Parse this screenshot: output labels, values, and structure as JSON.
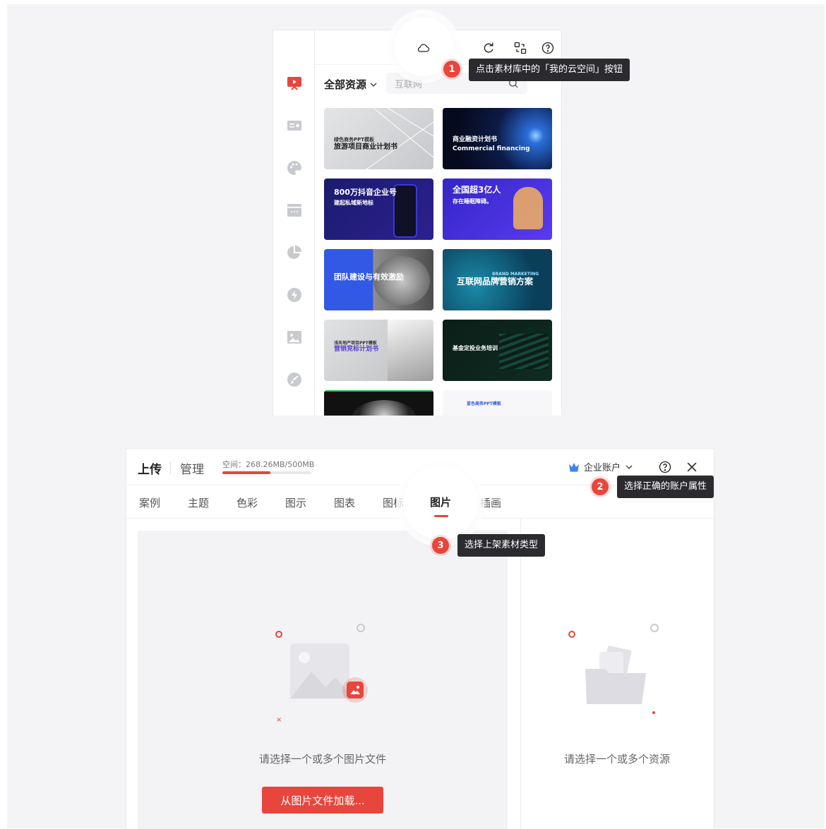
{
  "library": {
    "toolbar_icons": [
      "cloud-icon",
      "refresh-icon",
      "exchange-icon",
      "help-icon",
      "close-icon"
    ],
    "rail_icons": [
      "presentation-icon",
      "card-icon",
      "palette-icon",
      "table-icon",
      "pie-chart-icon",
      "bolt-icon",
      "image-icon",
      "brush-icon"
    ],
    "filter_label": "全部资源",
    "search_placeholder": "互联网",
    "thumbnails": [
      {
        "title": "旅游项目商业计划书",
        "subtitle": "绿色商务PPT模板",
        "bg": "#d9dadc",
        "fg": "#1a1a1a"
      },
      {
        "title": "商业融资计划书",
        "subtitle": "Commercial financing",
        "bg": "#0a1330",
        "fg": "#ffffff"
      },
      {
        "title": "800万抖音企业号",
        "subtitle": "建起私域新地标",
        "bg": "#1f1a6b",
        "fg": "#ffffff"
      },
      {
        "title": "全国超3亿人",
        "subtitle": "存在睡眠障碍。",
        "bg": "#3a2fc9",
        "fg": "#ffffff"
      },
      {
        "title": "团队建设与有效激励",
        "subtitle": "",
        "bg": "#3159e6",
        "fg": "#ffffff"
      },
      {
        "title": "互联网品牌营销方案",
        "subtitle": "BRAND MARKETING PLAN",
        "bg": "#0f5a7a",
        "fg": "#ffffff"
      },
      {
        "title": "营销竞标计划书",
        "subtitle": "浅灰地产项目PPT模板",
        "bg": "#d7d8da",
        "fg": "#1a1a1a"
      },
      {
        "title": "基金定投业务培训",
        "subtitle": "",
        "bg": "#0c2a22",
        "fg": "#ffffff"
      },
      {
        "title": "",
        "subtitle": "",
        "bg": "#111111",
        "fg": "#ffffff"
      },
      {
        "title": "",
        "subtitle": "蓝色商务PPT模板",
        "bg": "#f7f7f9",
        "fg": "#3159e6"
      }
    ]
  },
  "tips": {
    "step1": {
      "num": "1",
      "text": "点击素材库中的「我的云空间」按钮"
    },
    "step2": {
      "num": "2",
      "text": "选择正确的账户属性"
    },
    "step3": {
      "num": "3",
      "text": "选择上架素材类型"
    }
  },
  "dialog": {
    "upload_tab": "上传",
    "manage_tab": "管理",
    "space_text": "空间：268.26MB/500MB",
    "space_used_fraction": 0.537,
    "account_label": "企业账户",
    "tabs": [
      "案例",
      "主题",
      "色彩",
      "图示",
      "图表",
      "图标",
      "图片",
      "插画"
    ],
    "active_tab": "图片",
    "left_empty": "请选择一个或多个图片文件",
    "load_button": "从图片文件加载...",
    "right_empty": "请选择一个或多个资源"
  },
  "colors": {
    "accent": "#e8453c",
    "tooltip_bg": "#2b2b2f",
    "crown": "#3b82f6"
  }
}
